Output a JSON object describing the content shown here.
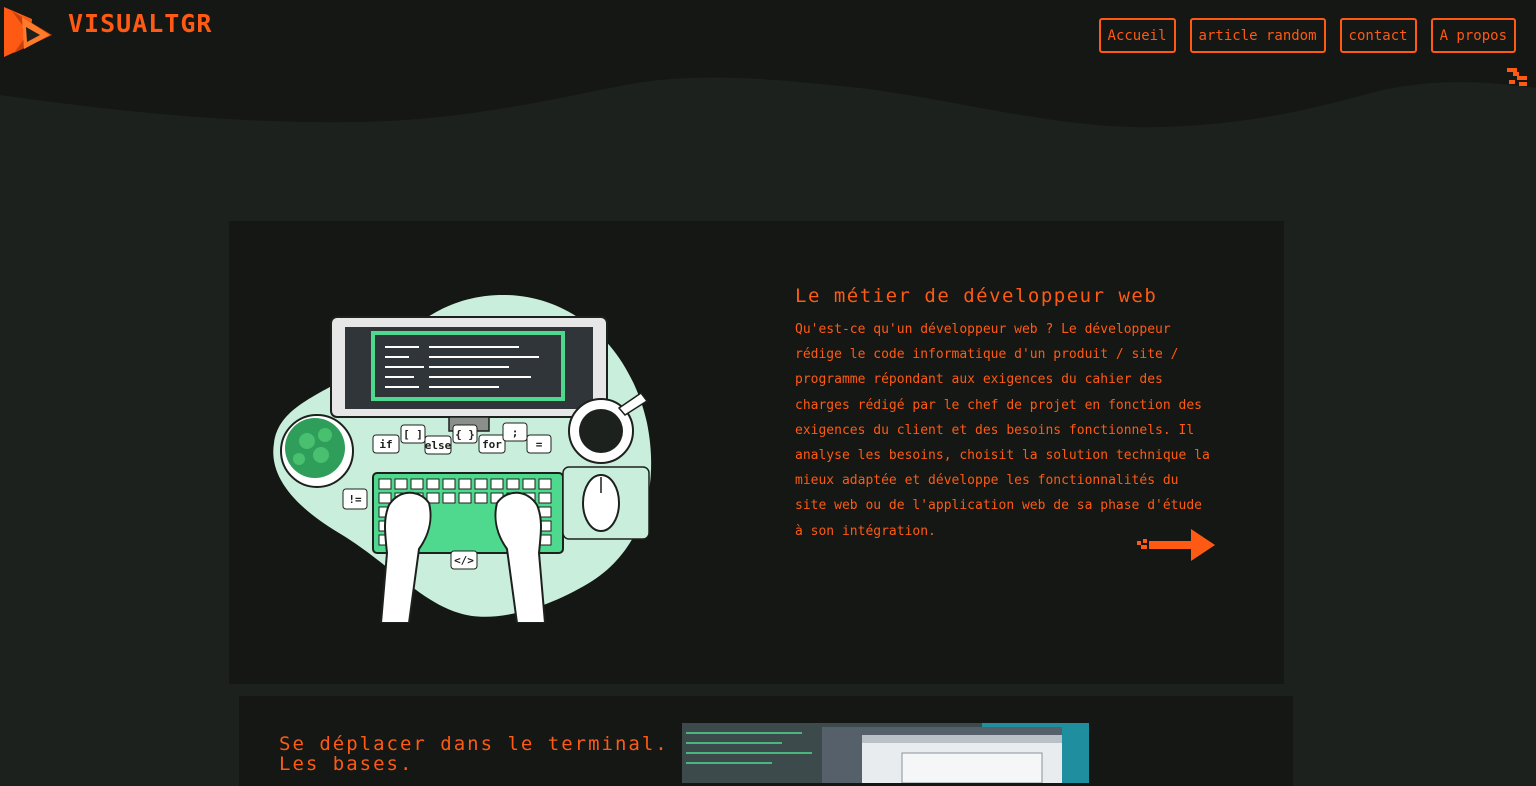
{
  "header": {
    "brand": "VISUALTGR",
    "nav": [
      {
        "label": "Accueil"
      },
      {
        "label": "article random"
      },
      {
        "label": "contact"
      },
      {
        "label": "A propos"
      }
    ]
  },
  "featured": {
    "title": "Le métier de développeur web",
    "body": "Qu'est-ce qu'un développeur web ? Le développeur rédige le code informatique d'un produit / site / programme répondant aux exigences du cahier des charges rédigé par le chef de projet en fonction des exigences du client et des besoins fonctionnels. Il analyse les besoins, choisit la solution technique la mieux adaptée et développe les fonctionnalités du site web ou de l'application web de sa phase d'étude à son intégration.",
    "illustration_labels": [
      "if",
      "[ ]",
      "else",
      "{ }",
      "for",
      ";",
      "=",
      "!=",
      "</>"
    ]
  },
  "second": {
    "title_line1": "Se déplacer dans le terminal.",
    "title_line2": "Les bases."
  },
  "colors": {
    "accent": "#ff5a14",
    "background": "#1d211d",
    "card": "#141713",
    "mint": "#c9eedc"
  },
  "icons": {
    "logo": "play-triangle-logo",
    "menu": "hamburger-glitch-icon",
    "read_more": "arrow-right-icon"
  }
}
